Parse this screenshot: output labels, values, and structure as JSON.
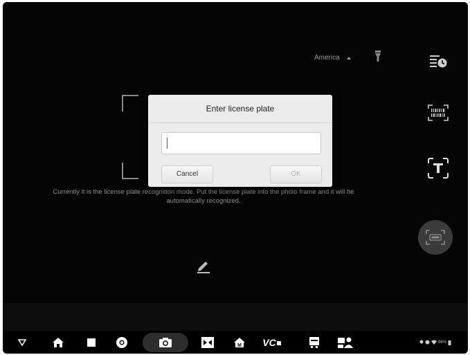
{
  "camera": {
    "region_label": "America",
    "hint_text": "Currently it is the license plate recognition mode. Put the license plate into the photo frame and it will be automatically recognized."
  },
  "side_toolbar": {
    "icons": [
      "history-icon",
      "barcode-scan-icon",
      "text-recognition-icon",
      "license-plate-scan-icon"
    ],
    "active": "license-plate-scan-icon"
  },
  "dialog": {
    "title": "Enter license plate",
    "input_value": "",
    "cancel_label": "Cancel",
    "ok_label": "OK"
  },
  "navbar": {
    "vc_label": "VC",
    "active": "camera",
    "status_text": "96%"
  },
  "colors": {
    "dialog_bg": "#ececec",
    "screen_bg": "#000000",
    "active_button_bg": "#3b3b3b",
    "ok_disabled_text": "#b4b4b4"
  }
}
